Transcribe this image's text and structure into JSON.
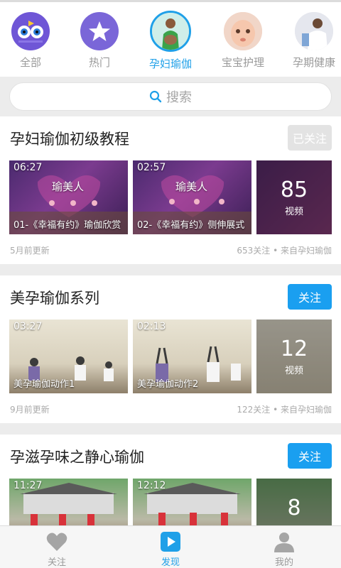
{
  "categories": [
    {
      "label": "全部",
      "icon": "owl-icon",
      "active": false
    },
    {
      "label": "热门",
      "icon": "star-icon",
      "active": false
    },
    {
      "label": "孕妇瑜伽",
      "icon": "pregnant-woman-avatar",
      "active": true
    },
    {
      "label": "宝宝护理",
      "icon": "baby-avatar",
      "active": false
    },
    {
      "label": "孕期健康",
      "icon": "doctor-avatar",
      "active": false
    }
  ],
  "search": {
    "placeholder": "搜索"
  },
  "sections": [
    {
      "title": "孕妇瑜伽初级教程",
      "follow_label": "已关注",
      "followed": true,
      "videos": [
        {
          "duration": "06:27",
          "caption": "01-《幸福有约》瑜伽欣赏",
          "watermark": "瑜美人"
        },
        {
          "duration": "02:57",
          "caption": "02-《幸福有约》侧伸展式",
          "watermark": "瑜美人"
        }
      ],
      "more_count": "85",
      "more_unit": "视频",
      "updated": "5月前更新",
      "stats": "653关注 • 来自孕妇瑜伽"
    },
    {
      "title": "美孕瑜伽系列",
      "follow_label": "关注",
      "followed": false,
      "videos": [
        {
          "duration": "03:27",
          "caption": "美孕瑜伽动作1"
        },
        {
          "duration": "02:13",
          "caption": "美孕瑜伽动作2"
        }
      ],
      "more_count": "12",
      "more_unit": "视频",
      "updated": "9月前更新",
      "stats": "122关注 • 来自孕妇瑜伽"
    },
    {
      "title": "孕滋孕味之静心瑜伽",
      "follow_label": "关注",
      "followed": false,
      "videos": [
        {
          "duration": "11:27",
          "caption": ""
        },
        {
          "duration": "12:12",
          "caption": ""
        }
      ],
      "more_count": "8",
      "more_unit": "",
      "updated": "",
      "stats": ""
    }
  ],
  "tabs": [
    {
      "label": "关注",
      "icon": "heart-icon",
      "active": false
    },
    {
      "label": "发现",
      "icon": "play-icon",
      "active": true
    },
    {
      "label": "我的",
      "icon": "user-icon",
      "active": false
    }
  ],
  "colors": {
    "accent": "#1fa0e8",
    "button": "#1a9ff0",
    "muted": "#9a9a9a"
  }
}
